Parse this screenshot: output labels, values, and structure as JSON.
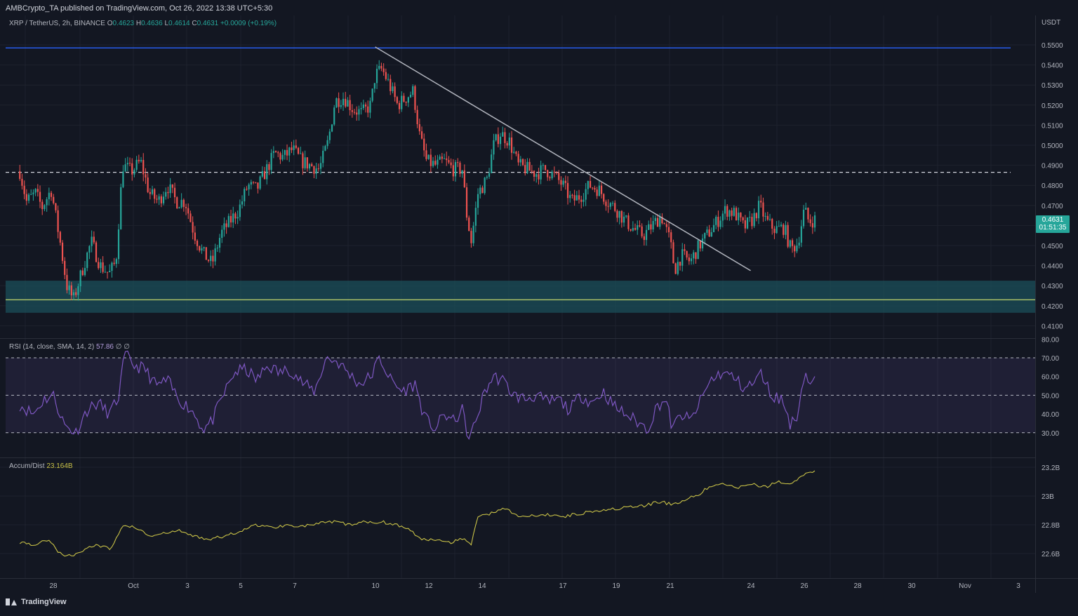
{
  "header": {
    "publish_line": "AMBCrypto_TA published on TradingView.com, Oct 26, 2022 13:38 UTC+5:30",
    "symbol": "XRP / TetherUS, 2h, BINANCE",
    "o_label": "O",
    "o": "0.4623",
    "h_label": "H",
    "h": "0.4636",
    "l_label": "L",
    "l": "0.4614",
    "c_label": "C",
    "c": "0.4631",
    "change": "+0.0009 (+0.19%)"
  },
  "price_tag": {
    "price": "0.4631",
    "countdown": "01:51:35"
  },
  "rsi_legend": {
    "label": "RSI (14, close, SMA, 14, 2)",
    "value": "57.86",
    "extra": "∅ ∅"
  },
  "ad_legend": {
    "label": "Accum/Dist",
    "value": "23.164B"
  },
  "footer": {
    "brand": "TradingView"
  },
  "colors": {
    "background": "#131722",
    "up": "#26a69a",
    "down": "#ef5350",
    "rsi": "#7e57c2",
    "ad": "#c9c247",
    "support_zone": "#1b4f5a",
    "resistance": "#2962ff",
    "trendline": "#b2b5be"
  },
  "chart_data": [
    {
      "type": "candlestick",
      "title": "XRP / TetherUS, 2h, BINANCE",
      "y_axis_unit": "USDT",
      "ylim": [
        0.405,
        0.556
      ],
      "y_ticks": [
        "0.5500",
        "0.5400",
        "0.5300",
        "0.5200",
        "0.5100",
        "0.5000",
        "0.4900",
        "0.4800",
        "0.4700",
        "0.4600",
        "0.4500",
        "0.4400",
        "0.4300",
        "0.4200",
        "0.4100"
      ],
      "x_ticks": [
        "28",
        "Oct",
        "3",
        "5",
        "7",
        "10",
        "12",
        "14",
        "17",
        "19",
        "21",
        "24",
        "26",
        "28",
        "30",
        "Nov",
        "3"
      ],
      "resistance_level": 0.5485,
      "dashed_level": 0.4865,
      "support_zone": [
        0.4165,
        0.4325
      ],
      "support_line": 0.423,
      "trendline": {
        "from": [
          "Oct 10",
          0.549
        ],
        "to": [
          "Oct 24",
          0.4375
        ]
      },
      "close_path": [
        [
          "Sep 26 18:00",
          0.487
        ],
        [
          "Sep 27 00:00",
          0.472
        ],
        [
          "Sep 27 08:00",
          0.476
        ],
        [
          "Sep 27 14:00",
          0.469
        ],
        [
          "Sep 27 22:00",
          0.478
        ],
        [
          "Sep 28 06:00",
          0.452
        ],
        [
          "Sep 28 12:00",
          0.43
        ],
        [
          "Sep 28 18:00",
          0.423
        ],
        [
          "Sep 29 02:00",
          0.438
        ],
        [
          "Sep 29 10:00",
          0.452
        ],
        [
          "Sep 29 18:00",
          0.44
        ],
        [
          "Sep 30 02:00",
          0.436
        ],
        [
          "Sep 30 08:00",
          0.442
        ],
        [
          "Sep 30 14:00",
          0.49
        ],
        [
          "Sep 30 22:00",
          0.487
        ],
        [
          "Oct 1 06:00",
          0.492
        ],
        [
          "Oct 1 14:00",
          0.476
        ],
        [
          "Oct 1 22:00",
          0.472
        ],
        [
          "Oct 2 06:00",
          0.48
        ],
        [
          "Oct 2 14:00",
          0.472
        ],
        [
          "Oct 2 22:00",
          0.472
        ],
        [
          "Oct 3 06:00",
          0.456
        ],
        [
          "Oct 3 14:00",
          0.446
        ],
        [
          "Oct 3 22:00",
          0.441
        ],
        [
          "Oct 4 06:00",
          0.456
        ],
        [
          "Oct 4 14:00",
          0.462
        ],
        [
          "Oct 4 22:00",
          0.468
        ],
        [
          "Oct 5 06:00",
          0.48
        ],
        [
          "Oct 5 14:00",
          0.478
        ],
        [
          "Oct 5 22:00",
          0.487
        ],
        [
          "Oct 6 06:00",
          0.496
        ],
        [
          "Oct 6 14:00",
          0.494
        ],
        [
          "Oct 6 22:00",
          0.498
        ],
        [
          "Oct 7 06:00",
          0.492
        ],
        [
          "Oct 7 14:00",
          0.49
        ],
        [
          "Oct 7 22:00",
          0.488
        ],
        [
          "Oct 8 06:00",
          0.502
        ],
        [
          "Oct 8 12:00",
          0.522
        ],
        [
          "Oct 8 20:00",
          0.524
        ],
        [
          "Oct 9 04:00",
          0.518
        ],
        [
          "Oct 9 12:00",
          0.516
        ],
        [
          "Oct 9 20:00",
          0.52
        ],
        [
          "Oct 10 00:00",
          0.535
        ],
        [
          "Oct 10 06:00",
          0.538
        ],
        [
          "Oct 10 12:00",
          0.531
        ],
        [
          "Oct 10 20:00",
          0.52
        ],
        [
          "Oct 11 04:00",
          0.524
        ],
        [
          "Oct 11 10:00",
          0.527
        ],
        [
          "Oct 11 16:00",
          0.504
        ],
        [
          "Oct 11 22:00",
          0.492
        ],
        [
          "Oct 12 06:00",
          0.49
        ],
        [
          "Oct 12 14:00",
          0.492
        ],
        [
          "Oct 12 22:00",
          0.488
        ],
        [
          "Oct 13 06:00",
          0.488
        ],
        [
          "Oct 13 10:00",
          0.465
        ],
        [
          "Oct 13 14:00",
          0.452
        ],
        [
          "Oct 13 20:00",
          0.476
        ],
        [
          "Oct 14 04:00",
          0.483
        ],
        [
          "Oct 14 10:00",
          0.5
        ],
        [
          "Oct 14 16:00",
          0.506
        ],
        [
          "Oct 15 00:00",
          0.502
        ],
        [
          "Oct 15 08:00",
          0.49
        ],
        [
          "Oct 15 16:00",
          0.488
        ],
        [
          "Oct 16 00:00",
          0.486
        ],
        [
          "Oct 16 08:00",
          0.488
        ],
        [
          "Oct 16 16:00",
          0.485
        ],
        [
          "Oct 17 00:00",
          0.48
        ],
        [
          "Oct 17 08:00",
          0.472
        ],
        [
          "Oct 17 16:00",
          0.475
        ],
        [
          "Oct 18 00:00",
          0.48
        ],
        [
          "Oct 18 08:00",
          0.478
        ],
        [
          "Oct 18 16:00",
          0.472
        ],
        [
          "Oct 19 00:00",
          0.468
        ],
        [
          "Oct 19 08:00",
          0.462
        ],
        [
          "Oct 19 16:00",
          0.458
        ],
        [
          "Oct 20 00:00",
          0.455
        ],
        [
          "Oct 20 08:00",
          0.46
        ],
        [
          "Oct 20 16:00",
          0.465
        ],
        [
          "Oct 21 00:00",
          0.452
        ],
        [
          "Oct 21 04:00",
          0.438
        ],
        [
          "Oct 21 10:00",
          0.445
        ],
        [
          "Oct 21 18:00",
          0.442
        ],
        [
          "Oct 22 02:00",
          0.45
        ],
        [
          "Oct 22 10:00",
          0.456
        ],
        [
          "Oct 22 18:00",
          0.462
        ],
        [
          "Oct 23 02:00",
          0.468
        ],
        [
          "Oct 23 10:00",
          0.466
        ],
        [
          "Oct 23 18:00",
          0.459
        ],
        [
          "Oct 24 02:00",
          0.463
        ],
        [
          "Oct 24 08:00",
          0.47
        ],
        [
          "Oct 24 14:00",
          0.462
        ],
        [
          "Oct 24 22:00",
          0.458
        ],
        [
          "Oct 25 06:00",
          0.459
        ],
        [
          "Oct 25 12:00",
          0.448
        ],
        [
          "Oct 25 18:00",
          0.451
        ],
        [
          "Oct 26 00:00",
          0.468
        ],
        [
          "Oct 26 04:00",
          0.462
        ],
        [
          "Oct 26 10:00",
          0.4631
        ]
      ]
    },
    {
      "type": "line",
      "title": "RSI (14, close, SMA, 14, 2)",
      "ylim": [
        20,
        80
      ],
      "y_ticks": [
        "80.00",
        "70.00",
        "60.00",
        "50.00",
        "40.00",
        "30.00"
      ],
      "levels": [
        70,
        50,
        30
      ],
      "series": [
        {
          "name": "RSI",
          "values": [
            [
              "Sep 26 18:00",
              45
            ],
            [
              "Sep 27 06:00",
              40
            ],
            [
              "Sep 27 16:00",
              48
            ],
            [
              "Sep 28 00:00",
              50
            ],
            [
              "Sep 28 10:00",
              34
            ],
            [
              "Sep 28 20:00",
              30
            ],
            [
              "Sep 29 06:00",
              42
            ],
            [
              "Sep 29 16:00",
              46
            ],
            [
              "Sep 30 02:00",
              40
            ],
            [
              "Sep 30 10:00",
              48
            ],
            [
              "Sep 30 16:00",
              72
            ],
            [
              "Oct 1 00:00",
              66
            ],
            [
              "Oct 1 10:00",
              64
            ],
            [
              "Oct 1 20:00",
              55
            ],
            [
              "Oct 2 06:00",
              58
            ],
            [
              "Oct 2 16:00",
              48
            ],
            [
              "Oct 3 04:00",
              42
            ],
            [
              "Oct 3 14:00",
              32
            ],
            [
              "Oct 3 22:00",
              36
            ],
            [
              "Oct 4 08:00",
              50
            ],
            [
              "Oct 4 18:00",
              62
            ],
            [
              "Oct 5 04:00",
              64
            ],
            [
              "Oct 5 14:00",
              58
            ],
            [
              "Oct 6 00:00",
              66
            ],
            [
              "Oct 6 10:00",
              62
            ],
            [
              "Oct 6 20:00",
              64
            ],
            [
              "Oct 7 08:00",
              56
            ],
            [
              "Oct 7 18:00",
              52
            ],
            [
              "Oct 8 04:00",
              70
            ],
            [
              "Oct 8 14:00",
              68
            ],
            [
              "Oct 9 00:00",
              62
            ],
            [
              "Oct 9 10:00",
              56
            ],
            [
              "Oct 9 20:00",
              60
            ],
            [
              "Oct 10 04:00",
              70
            ],
            [
              "Oct 10 14:00",
              58
            ],
            [
              "Oct 11 00:00",
              52
            ],
            [
              "Oct 11 12:00",
              56
            ],
            [
              "Oct 11 20:00",
              38
            ],
            [
              "Oct 12 06:00",
              32
            ],
            [
              "Oct 12 14:00",
              40
            ],
            [
              "Oct 12 22:00",
              36
            ],
            [
              "Oct 13 06:00",
              42
            ],
            [
              "Oct 13 12:00",
              26
            ],
            [
              "Oct 13 18:00",
              36
            ],
            [
              "Oct 14 02:00",
              52
            ],
            [
              "Oct 14 10:00",
              60
            ],
            [
              "Oct 14 18:00",
              58
            ],
            [
              "Oct 15 04:00",
              50
            ],
            [
              "Oct 15 14:00",
              48
            ],
            [
              "Oct 16 00:00",
              50
            ],
            [
              "Oct 16 10:00",
              46
            ],
            [
              "Oct 16 20:00",
              48
            ],
            [
              "Oct 17 06:00",
              42
            ],
            [
              "Oct 17 16:00",
              50
            ],
            [
              "Oct 18 02:00",
              46
            ],
            [
              "Oct 18 12:00",
              52
            ],
            [
              "Oct 18 22:00",
              44
            ],
            [
              "Oct 19 08:00",
              40
            ],
            [
              "Oct 19 18:00",
              36
            ],
            [
              "Oct 20 04:00",
              32
            ],
            [
              "Oct 20 12:00",
              44
            ],
            [
              "Oct 20 20:00",
              48
            ],
            [
              "Oct 21 02:00",
              32
            ],
            [
              "Oct 21 10:00",
              40
            ],
            [
              "Oct 21 18:00",
              36
            ],
            [
              "Oct 22 04:00",
              48
            ],
            [
              "Oct 22 12:00",
              58
            ],
            [
              "Oct 22 22:00",
              62
            ],
            [
              "Oct 23 08:00",
              60
            ],
            [
              "Oct 23 18:00",
              54
            ],
            [
              "Oct 24 02:00",
              56
            ],
            [
              "Oct 24 10:00",
              62
            ],
            [
              "Oct 24 18:00",
              50
            ],
            [
              "Oct 25 04:00",
              48
            ],
            [
              "Oct 25 12:00",
              34
            ],
            [
              "Oct 25 18:00",
              40
            ],
            [
              "Oct 26 00:00",
              62
            ],
            [
              "Oct 26 06:00",
              56
            ],
            [
              "Oct 26 10:00",
              57.86
            ]
          ]
        }
      ]
    },
    {
      "type": "line",
      "title": "Accum/Dist",
      "ylim": [
        22.5,
        23.25
      ],
      "y_ticks": [
        "23.2B",
        "23B",
        "22.8B",
        "22.6B"
      ],
      "series": [
        {
          "name": "Accum/Dist",
          "values": [
            [
              "Sep 26 18:00",
              22.68
            ],
            [
              "Sep 27 08:00",
              22.66
            ],
            [
              "Sep 27 20:00",
              22.7
            ],
            [
              "Sep 28 06:00",
              22.6
            ],
            [
              "Sep 28 16:00",
              22.58
            ],
            [
              "Sep 29 04:00",
              22.63
            ],
            [
              "Sep 29 14:00",
              22.66
            ],
            [
              "Sep 30 04:00",
              22.63
            ],
            [
              "Sep 30 14:00",
              22.8
            ],
            [
              "Oct 1 02:00",
              22.78
            ],
            [
              "Oct 1 14:00",
              22.72
            ],
            [
              "Oct 2 04:00",
              22.74
            ],
            [
              "Oct 2 16:00",
              22.76
            ],
            [
              "Oct 3 06:00",
              22.72
            ],
            [
              "Oct 3 20:00",
              22.7
            ],
            [
              "Oct 4 10:00",
              22.72
            ],
            [
              "Oct 5 00:00",
              22.76
            ],
            [
              "Oct 5 14:00",
              22.8
            ],
            [
              "Oct 6 04:00",
              22.78
            ],
            [
              "Oct 6 18:00",
              22.8
            ],
            [
              "Oct 7 08:00",
              22.79
            ],
            [
              "Oct 7 22:00",
              22.81
            ],
            [
              "Oct 8 12:00",
              22.82
            ],
            [
              "Oct 9 02:00",
              22.8
            ],
            [
              "Oct 9 16:00",
              22.82
            ],
            [
              "Oct 10 06:00",
              22.82
            ],
            [
              "Oct 10 20:00",
              22.8
            ],
            [
              "Oct 11 08:00",
              22.76
            ],
            [
              "Oct 11 16:00",
              22.7
            ],
            [
              "Oct 12 06:00",
              22.7
            ],
            [
              "Oct 12 20:00",
              22.68
            ],
            [
              "Oct 13 08:00",
              22.71
            ],
            [
              "Oct 13 14:00",
              22.66
            ],
            [
              "Oct 13 20:00",
              22.86
            ],
            [
              "Oct 14 08:00",
              22.88
            ],
            [
              "Oct 14 20:00",
              22.92
            ],
            [
              "Oct 15 08:00",
              22.86
            ],
            [
              "Oct 15 22:00",
              22.86
            ],
            [
              "Oct 16 12:00",
              22.87
            ],
            [
              "Oct 17 02:00",
              22.86
            ],
            [
              "Oct 17 16:00",
              22.88
            ],
            [
              "Oct 18 06:00",
              22.9
            ],
            [
              "Oct 18 20:00",
              22.91
            ],
            [
              "Oct 19 10:00",
              22.92
            ],
            [
              "Oct 20 00:00",
              22.93
            ],
            [
              "Oct 20 14:00",
              22.96
            ],
            [
              "Oct 21 04:00",
              22.94
            ],
            [
              "Oct 21 14:00",
              22.98
            ],
            [
              "Oct 22 00:00",
              23.0
            ],
            [
              "Oct 22 10:00",
              23.06
            ],
            [
              "Oct 22 22:00",
              23.08
            ],
            [
              "Oct 23 12:00",
              23.06
            ],
            [
              "Oct 24 02:00",
              23.08
            ],
            [
              "Oct 24 14:00",
              23.06
            ],
            [
              "Oct 25 00:00",
              23.1
            ],
            [
              "Oct 25 12:00",
              23.08
            ],
            [
              "Oct 25 22:00",
              23.14
            ],
            [
              "Oct 26 06:00",
              23.18
            ],
            [
              "Oct 26 10:00",
              23.164
            ]
          ]
        }
      ]
    }
  ]
}
